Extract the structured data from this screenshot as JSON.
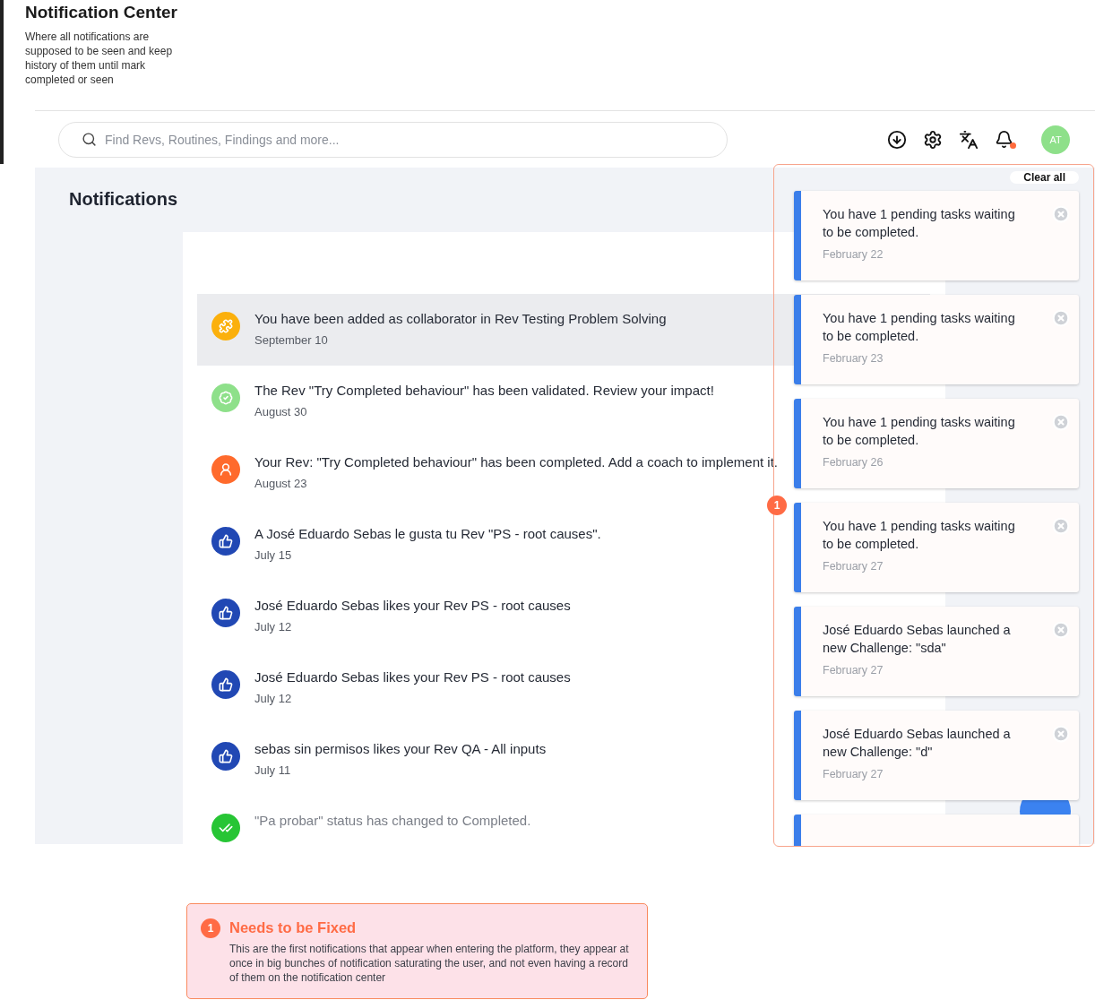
{
  "header": {
    "title": "Notification Center",
    "description": "Where all notifications are supposed to be seen and keep history of them until mark completed or seen"
  },
  "search": {
    "placeholder": "Find Revs, Routines, Findings and more..."
  },
  "toolbar": {
    "has_unread": true,
    "avatar": "AT"
  },
  "page": {
    "title": "Notifications"
  },
  "notifications": [
    {
      "kind": "collaborator",
      "text": "You have been added as collaborator in Rev Testing Problem Solving",
      "date": "September 10",
      "selected": true,
      "seen": false
    },
    {
      "kind": "validated",
      "text": "The Rev \"Try Completed behaviour\" has been validated. Review your impact!",
      "date": "August 30",
      "selected": false,
      "seen": false
    },
    {
      "kind": "coach",
      "text": "Your Rev: \"Try Completed behaviour\" has been completed. Add a coach to implement it.",
      "date": "August 23",
      "selected": false,
      "seen": false
    },
    {
      "kind": "like",
      "text": "A José Eduardo Sebas le gusta tu Rev \"PS - root causes\".",
      "date": "July 15",
      "selected": false,
      "seen": false
    },
    {
      "kind": "like",
      "text": "José Eduardo Sebas likes your Rev PS - root causes",
      "date": "July 12",
      "selected": false,
      "seen": false
    },
    {
      "kind": "like",
      "text": "José Eduardo Sebas likes your Rev PS - root causes",
      "date": "July 12",
      "selected": false,
      "seen": false
    },
    {
      "kind": "like",
      "text": "sebas sin permisos likes your Rev QA - All inputs",
      "date": "July 11",
      "selected": false,
      "seen": false
    },
    {
      "kind": "completed",
      "text": "\"Pa probar\" status has changed to Completed.",
      "selected": false,
      "seen": true
    }
  ],
  "toast_panel": {
    "badge": "1",
    "clear_label": "Clear all",
    "toasts": [
      {
        "text": "You have 1 pending tasks waiting to be completed.",
        "date": "February 22"
      },
      {
        "text": "You have 1 pending tasks waiting to be completed.",
        "date": "February 23"
      },
      {
        "text": "You have 1 pending tasks waiting to be completed.",
        "date": "February 26"
      },
      {
        "text": "You have 1 pending tasks waiting to be completed.",
        "date": "February 27"
      },
      {
        "text": "José Eduardo Sebas launched a new Challenge: \"sda\"",
        "date": "February 27"
      },
      {
        "text": "José Eduardo Sebas launched a new Challenge: \"d\"",
        "date": "February 27"
      }
    ]
  },
  "annotation": {
    "badge": "1",
    "title": "Needs to be Fixed",
    "body": "This are the first notifications that appear when entering the platform, they appear at once in big bunches of notification saturating the user, and not even having a record of them on the notification center"
  }
}
